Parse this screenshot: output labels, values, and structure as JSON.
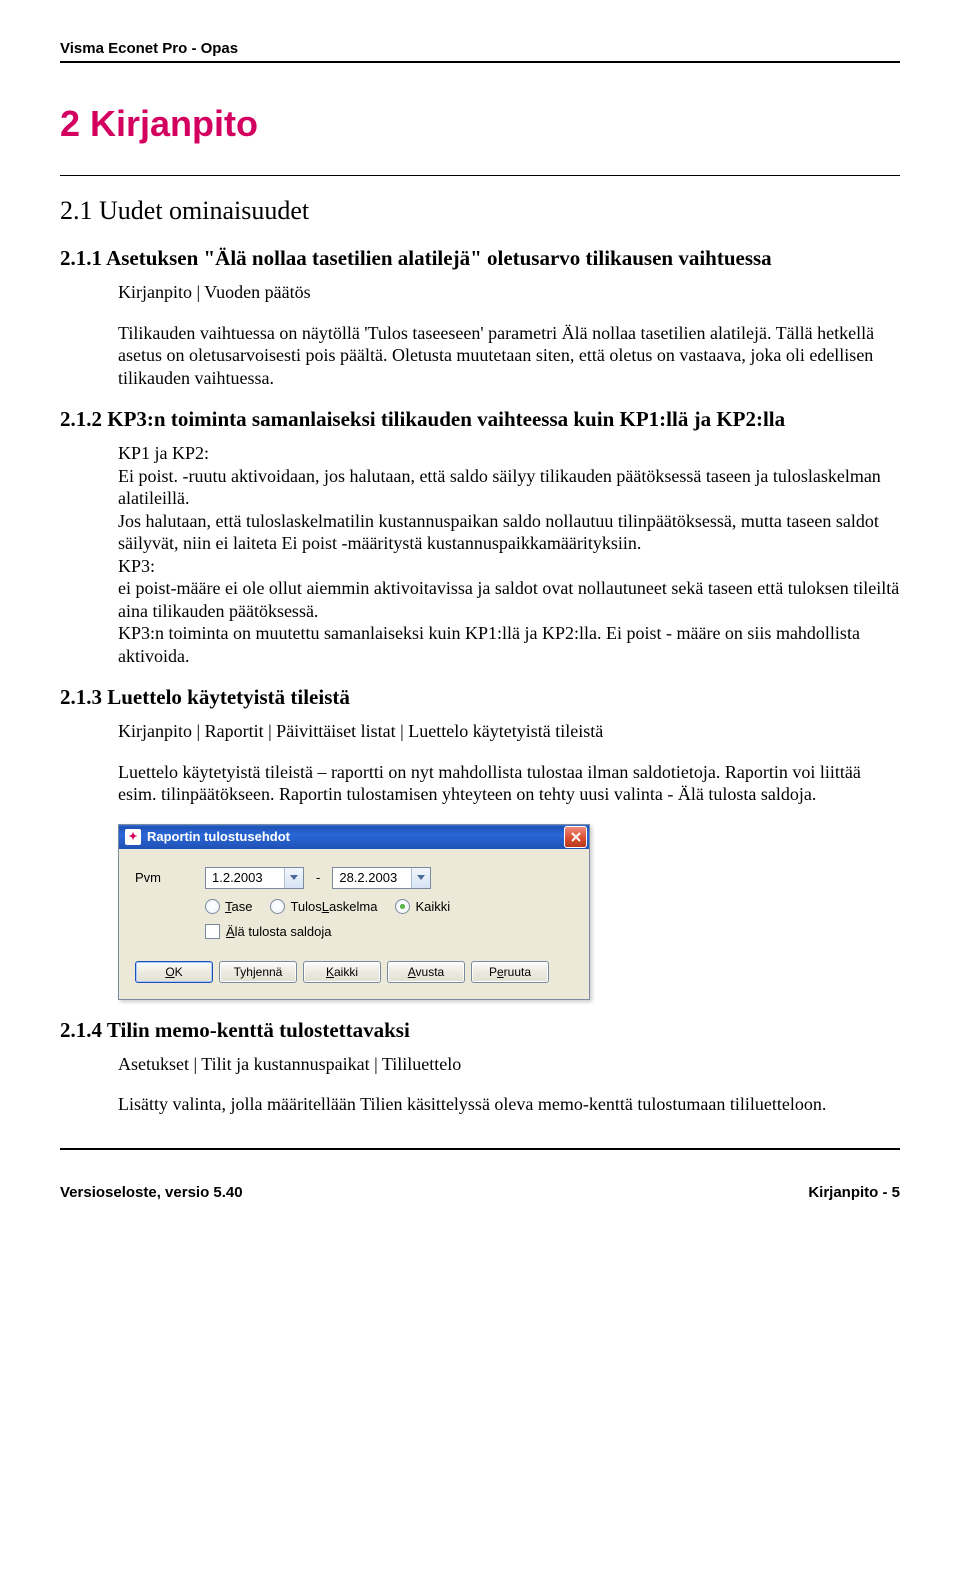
{
  "header": {
    "title": "Visma Econet Pro - Opas"
  },
  "chapter": {
    "number_title": "2   Kirjanpito"
  },
  "s21": {
    "title": "2.1 Uudet ominaisuudet",
    "s211": {
      "title": "2.1.1 Asetuksen \"Älä nollaa tasetilien alatilejä\" oletusarvo tilikausen vaihtuessa",
      "nav": "Kirjanpito | Vuoden päätös",
      "body": "Tilikauden vaihtuessa on näytöllä 'Tulos taseeseen' parametri Älä nollaa tasetilien alatilejä. Tällä hetkellä asetus on oletusarvoisesti pois päältä. Oletusta muutetaan siten, että oletus on vastaava, joka oli edellisen tilikauden vaihtuessa."
    },
    "s212": {
      "title": "2.1.2 KP3:n toiminta samanlaiseksi tilikauden vaihteessa kuin KP1:llä ja KP2:lla",
      "lead": "KP1 ja KP2:",
      "p1": "Ei poist. -ruutu aktivoidaan, jos halutaan, että saldo säilyy tilikauden päätöksessä taseen ja tuloslaskelman alatileillä.",
      "p2": "Jos halutaan, että tuloslaskelmatilin kustannuspaikan saldo nollautuu tilinpäätöksessä, mutta taseen saldot",
      "p3": "säilyvät, niin ei laiteta Ei poist -määritystä kustannuspaikkamäärityksiin.",
      "p4_lead": "KP3:",
      "p4": "ei poist-määre ei ole ollut aiemmin aktivoitavissa ja saldot ovat nollautuneet sekä taseen että tuloksen tileiltä aina tilikauden päätöksessä.",
      "p5": "KP3:n toiminta on muutettu samanlaiseksi kuin KP1:llä ja KP2:lla. Ei poist - määre on siis mahdollista aktivoida."
    },
    "s213": {
      "title": "2.1.3 Luettelo käytetyistä tileistä",
      "nav": "Kirjanpito | Raportit | Päivittäiset listat | Luettelo käytetyistä tileistä",
      "body": "Luettelo käytetyistä tileistä – raportti on nyt mahdollista tulostaa ilman saldotietoja. Raportin voi liittää esim. tilinpäätökseen. Raportin tulostamisen yhteyteen on tehty uusi valinta - Älä tulosta saldoja."
    },
    "s214": {
      "title": "2.1.4 Tilin memo-kenttä tulostettavaksi",
      "nav": "Asetukset | Tilit ja kustannuspaikat | Tililuettelo",
      "body": "Lisätty valinta, jolla määritellään Tilien käsittelyssä oleva memo-kenttä tulostumaan tililuetteloon."
    }
  },
  "dialog": {
    "title": "Raportin tulostusehdot",
    "pvm_label": "Pvm",
    "date_from": "1.2.2003",
    "date_to": "28.2.2003",
    "dash": "-",
    "radio": {
      "tase": "Tase",
      "tuloslaskelma": "TulosLaskelma",
      "kaikki": "Kaikki",
      "selected": "kaikki"
    },
    "checkbox": {
      "ala_tulosta": "Älä tulosta saldoja",
      "accel": "Ä"
    },
    "buttons": {
      "ok": "OK",
      "tyhjenna": "Tyhjennä",
      "kaikki": "Kaikki",
      "avusta": "Avusta",
      "peruuta": "Peruuta"
    }
  },
  "footer": {
    "left": "Versioseloste, versio 5.40",
    "right": "Kirjanpito - 5"
  }
}
